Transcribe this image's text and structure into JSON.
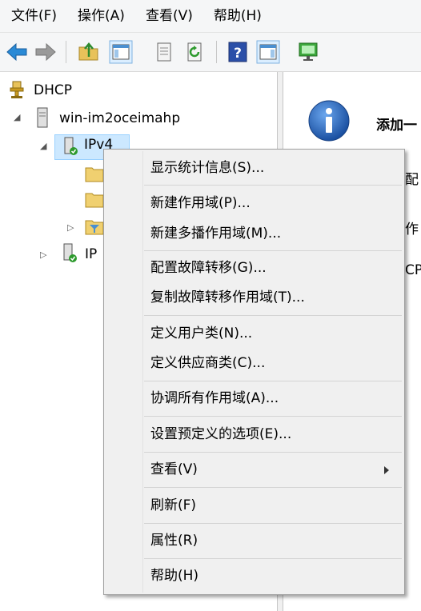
{
  "menubar": {
    "items": [
      "文件(F)",
      "操作(A)",
      "查看(V)",
      "帮助(H)"
    ]
  },
  "tree": {
    "root": "DHCP",
    "server": "win-im2oceimahp",
    "ipv4": "IPv4",
    "ipv6": "IP"
  },
  "result_pane": {
    "heading": "添加一",
    "line1": "配",
    "line2": "作",
    "line3": "CP"
  },
  "context_menu": {
    "items": [
      "显示统计信息(S)...",
      "新建作用域(P)...",
      "新建多播作用域(M)...",
      "配置故障转移(G)...",
      "复制故障转移作用域(T)...",
      "定义用户类(N)...",
      "定义供应商类(C)...",
      "协调所有作用域(A)...",
      "设置预定义的选项(E)...",
      "查看(V)",
      "刷新(F)",
      "属性(R)",
      "帮助(H)"
    ]
  },
  "colors": {
    "selection": "#cce8ff",
    "menu_bg": "#f0f0f0",
    "info_blue": "#1f5fb8"
  }
}
